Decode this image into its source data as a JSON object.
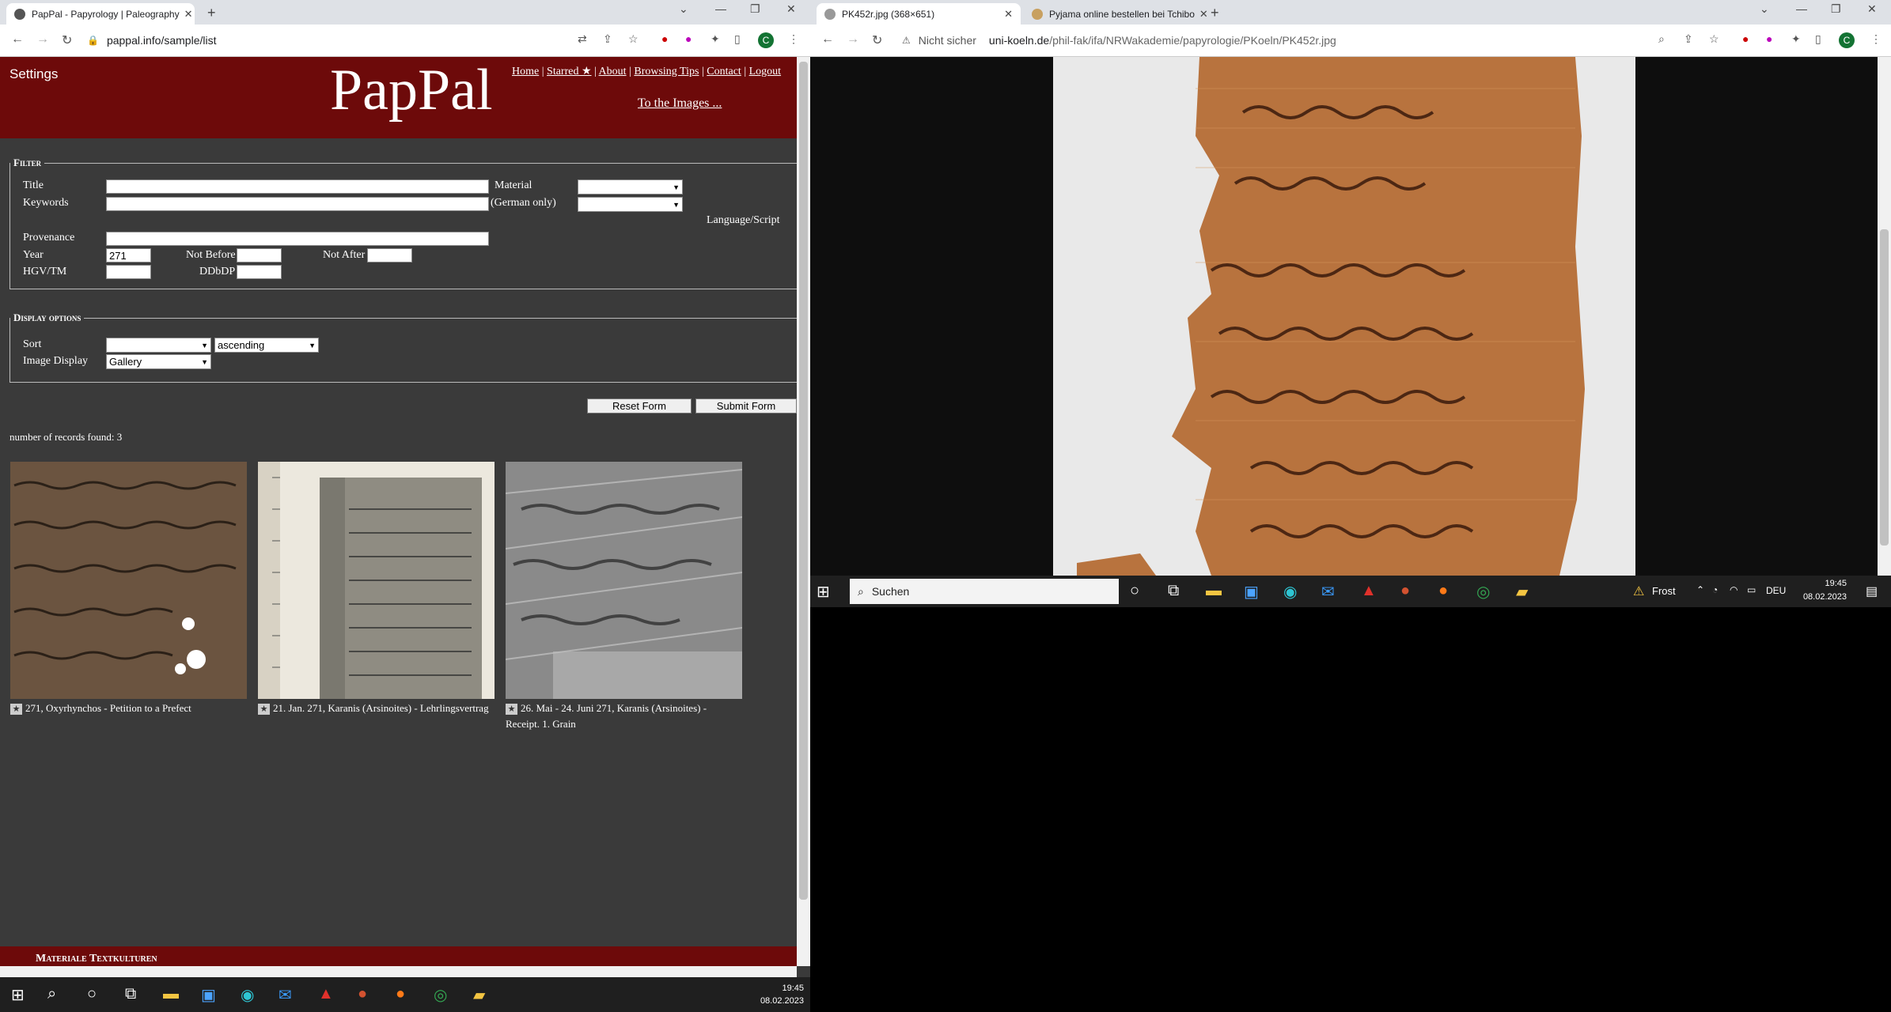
{
  "left_browser": {
    "tabs": [
      {
        "title": "PapPal - Papyrology | Paleography"
      }
    ],
    "url": "pappal.info/sample/list",
    "avatar_letter": "C"
  },
  "site": {
    "logo": "PapPal",
    "settings": "Settings",
    "nav": [
      "Home",
      "Starred ★",
      "About",
      "Browsing Tips",
      "Contact",
      "Logout"
    ],
    "to_images": "To the Images ..."
  },
  "filter": {
    "legend": "Filter",
    "title_label": "Title",
    "keywords_label": "Keywords",
    "german_only": "(German only)",
    "material_label": "Material",
    "language_label": "Language/Script",
    "provenance_label": "Provenance",
    "year_label": "Year",
    "year_value": "271",
    "not_before_label": "Not Before",
    "not_after_label": "Not After",
    "hgv_label": "HGV/TM",
    "ddbdp_label": "DDbDP"
  },
  "display": {
    "legend": "Display options",
    "sort_label": "Sort",
    "order_value": "ascending",
    "image_display_label": "Image Display",
    "image_display_value": "Gallery"
  },
  "buttons": {
    "reset": "Reset Form",
    "submit": "Submit Form"
  },
  "records_found": "number of records found: 3",
  "results": [
    {
      "caption": "271, Oxyrhynchos - Petition to a Prefect"
    },
    {
      "caption": "21. Jan. 271, Karanis (Arsinoites) - Lehrlingsvertrag"
    },
    {
      "caption": "26. Mai - 24. Juni 271, Karanis (Arsinoites) - Receipt. 1. Grain"
    }
  ],
  "footer_text": "Materiale Textkulturen",
  "left_taskbar": {
    "time": "19:45",
    "date": "08.02.2023"
  },
  "right_browser": {
    "tabs": [
      {
        "title": "PK452r.jpg (368×651)"
      },
      {
        "title": "Pyjama online bestellen bei Tchibo"
      }
    ],
    "security": "Nicht sicher",
    "url_host": "uni-koeln.de",
    "url_path": "/phil-fak/ifa/NRWakademie/papyrologie/PKoeln/PK452r.jpg",
    "avatar_letter": "C"
  },
  "right_taskbar": {
    "search_placeholder": "Suchen",
    "weather": "Frost",
    "lang": "DEU",
    "time": "19:45",
    "date": "08.02.2023"
  }
}
